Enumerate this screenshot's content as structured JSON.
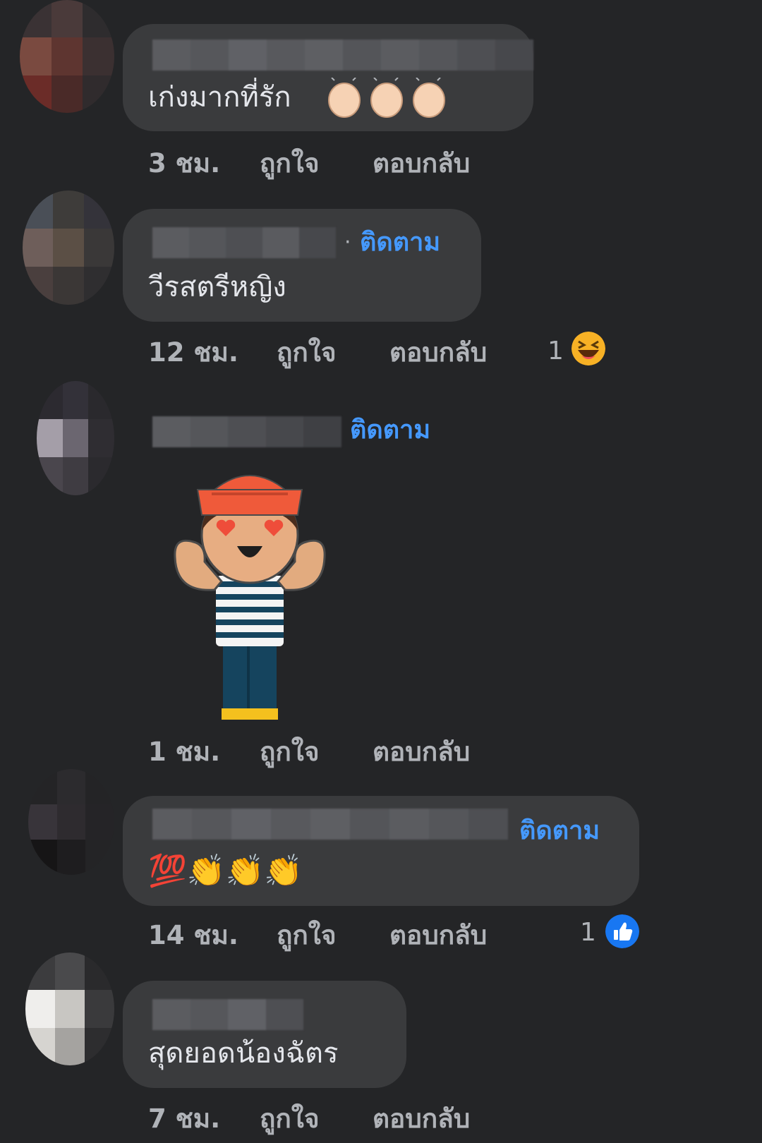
{
  "comments": [
    {
      "text": "เก่งมากที่รัก",
      "emoji": "👏🏻👏🏻👏🏻",
      "time": "3 ชม.",
      "like": "ถูกใจ",
      "reply": "ตอบกลับ"
    },
    {
      "follow": "ติดตาม",
      "text": "วีรสตรีหญิง",
      "time": "12 ชม.",
      "like": "ถูกใจ",
      "reply": "ตอบกลับ",
      "reaction_count": "1",
      "reaction_icon": "laugh-emoji"
    },
    {
      "follow": "ติดตาม",
      "sticker": "sailor-heart-eyes-sticker",
      "time": "1 ชม.",
      "like": "ถูกใจ",
      "reply": "ตอบกลับ"
    },
    {
      "follow": "ติดตาม",
      "emoji": "💯👏👏👏",
      "time": "14 ชม.",
      "like": "ถูกใจ",
      "reply": "ตอบกลับ",
      "reaction_count": "1",
      "reaction_icon": "like-thumb"
    },
    {
      "text": "สุดยอดน้องฉัตร",
      "time": "7 ชม.",
      "like": "ถูกใจ",
      "reply": "ตอบกลับ"
    }
  ],
  "colors": {
    "background": "#242527",
    "bubble": "#3a3b3d",
    "follow": "#4599ff",
    "meta": "#b0b3b8",
    "like_blue": "#1877f2"
  }
}
